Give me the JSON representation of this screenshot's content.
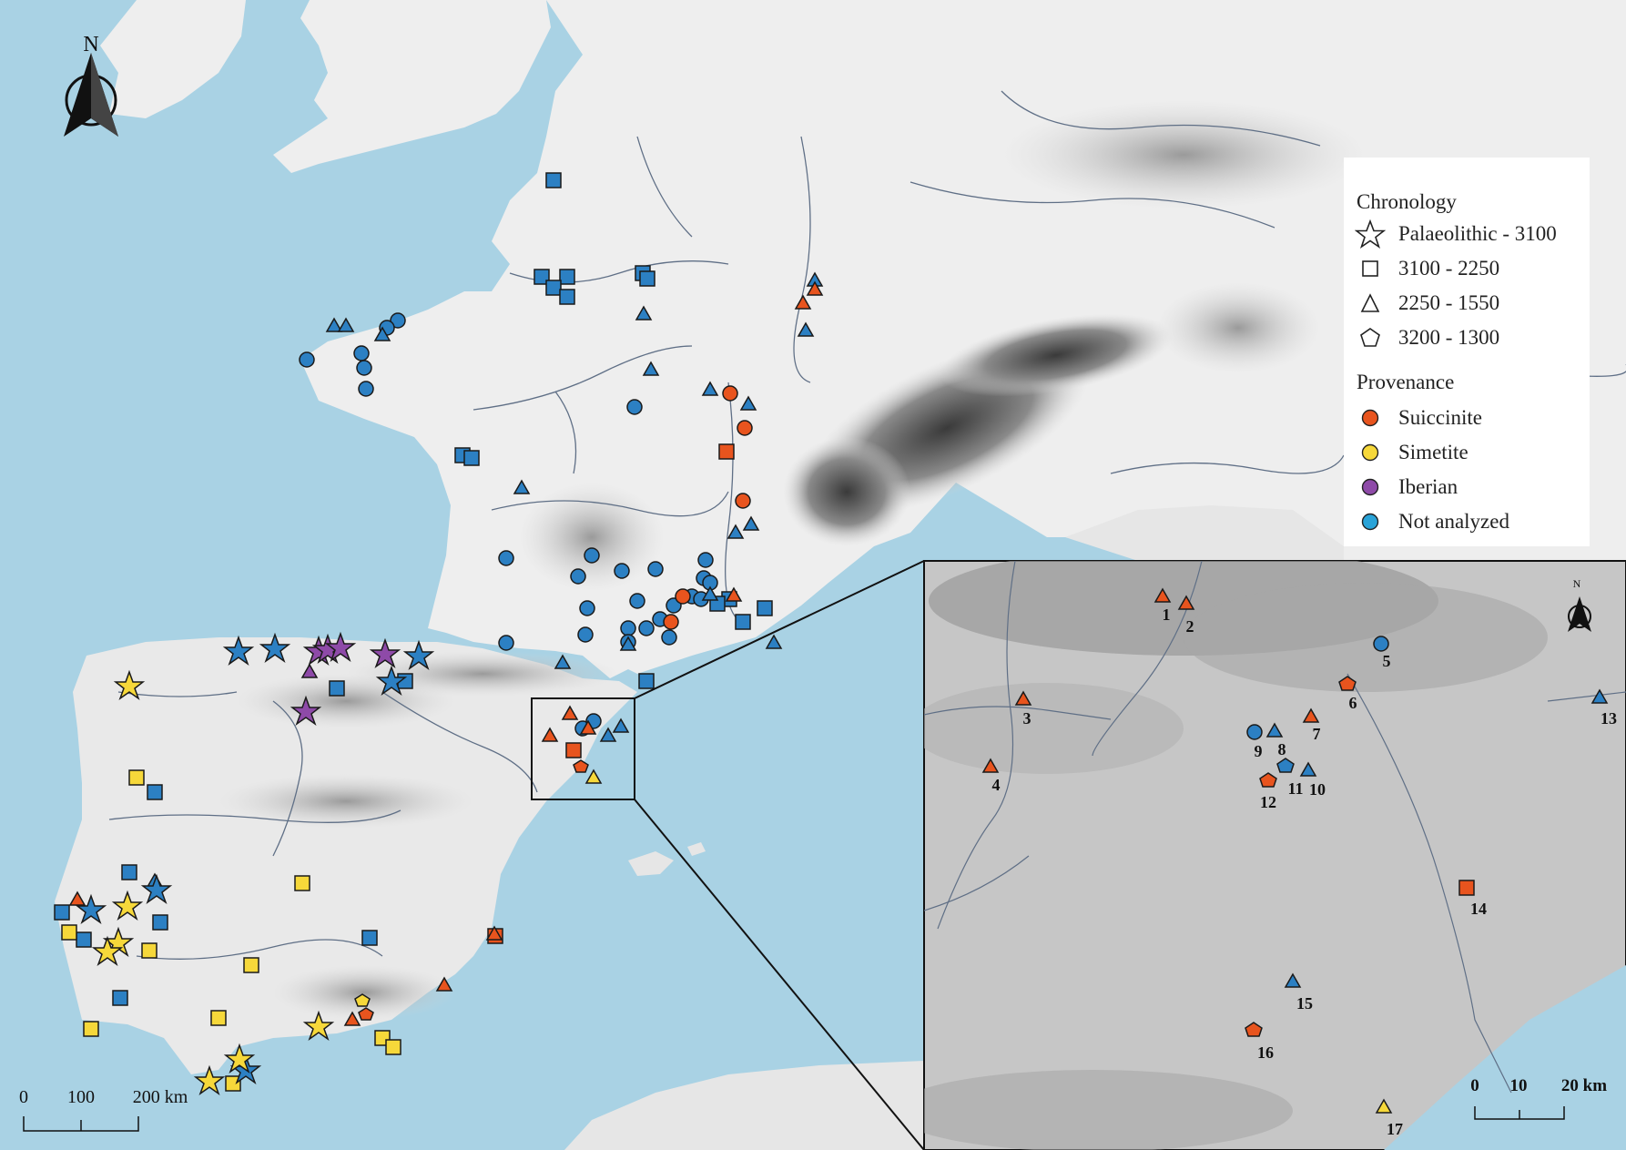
{
  "north_label": "N",
  "legend": {
    "chronology_title": "Chronology",
    "chronology": [
      {
        "shape": "star",
        "label": "Palaeolithic - 3100"
      },
      {
        "shape": "square",
        "label": "3100 - 2250"
      },
      {
        "shape": "triangle",
        "label": "2250 - 1550"
      },
      {
        "shape": "pentagon",
        "label": "3200 - 1300"
      }
    ],
    "provenance_title": "Provenance",
    "provenance": [
      {
        "label": "Suiccinite",
        "color": "#e8541e"
      },
      {
        "label": "Simetite",
        "color": "#f6d83a"
      },
      {
        "label": "Iberian",
        "color": "#8e4aa8"
      },
      {
        "label": "Not analyzed",
        "color": "#2c80c3"
      }
    ]
  },
  "main_scale": {
    "ticks": [
      "0",
      "100",
      "200 km"
    ]
  },
  "inset_scale": {
    "ticks": [
      "0",
      "10",
      "20 km"
    ]
  },
  "inset_sites": [
    "1",
    "2",
    "3",
    "4",
    "5",
    "6",
    "7",
    "8",
    "9",
    "10",
    "11",
    "12",
    "13",
    "14",
    "15",
    "16",
    "17"
  ],
  "colors": {
    "sea": "#a9d2e4",
    "land": "#ededed",
    "suiccinite": "#e8541e",
    "simetite": "#f6d83a",
    "iberian": "#8e4aa8",
    "not_analyzed": "#2c80c3"
  }
}
